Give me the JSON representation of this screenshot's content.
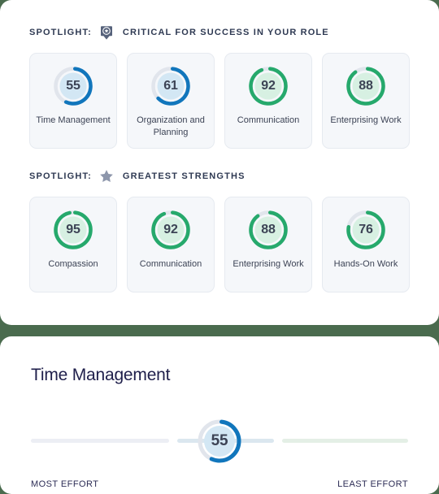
{
  "theme": {
    "page_background": "#4a6b4e",
    "panel_background": "#ffffff",
    "card_background": "#f5f7fa",
    "blue_accent": "#1176bc",
    "blue_fill": "#d3e7f4",
    "green_accent": "#26a96c",
    "green_fill": "#d7f0e2",
    "track_empty": "#e1e5ec",
    "text_dark": "#2f3a53",
    "title_color": "#1f1f4b"
  },
  "sections": [
    {
      "id": "critical-for-success",
      "spotlight_label": "SPOTLIGHT:",
      "icon": "award-badge-icon",
      "spotlight_title": "CRITICAL FOR SUCCESS IN YOUR ROLE",
      "cards": [
        {
          "value": 55,
          "label": "Time Management",
          "color": "blue"
        },
        {
          "value": 61,
          "label": "Organization and Planning",
          "color": "blue"
        },
        {
          "value": 92,
          "label": "Communication",
          "color": "green"
        },
        {
          "value": 88,
          "label": "Enterprising Work",
          "color": "green"
        }
      ]
    },
    {
      "id": "greatest-strengths",
      "spotlight_label": "SPOTLIGHT:",
      "icon": "star-icon",
      "spotlight_title": "GREATEST STRENGTHS",
      "cards": [
        {
          "value": 95,
          "label": "Compassion",
          "color": "green"
        },
        {
          "value": 92,
          "label": "Communication",
          "color": "green"
        },
        {
          "value": 88,
          "label": "Enterprising Work",
          "color": "green"
        },
        {
          "value": 76,
          "label": "Hands-On Work",
          "color": "green"
        }
      ]
    }
  ],
  "detail": {
    "title": "Time Management",
    "value": 55,
    "color": "blue",
    "left_label": "MOST EFFORT",
    "right_label": "LEAST EFFORT"
  }
}
